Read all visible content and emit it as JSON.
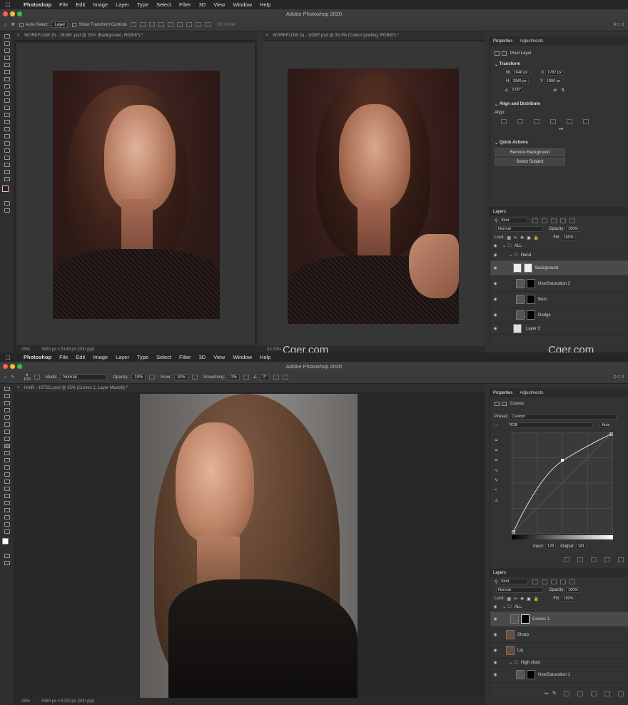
{
  "menu": {
    "app": "Photoshop",
    "items": [
      "File",
      "Edit",
      "Image",
      "Layer",
      "Type",
      "Select",
      "Filter",
      "3D",
      "View",
      "Window",
      "Help"
    ]
  },
  "app_title": "Adobe Photoshop 2020",
  "w1": {
    "opts": {
      "auto_select": "Auto-Select:",
      "layer": "Layer",
      "show_transform": "Show Transform Controls",
      "mode_3d": "3D Mode:"
    },
    "tab_left": "WORKFLOW 2b - 18268 .psd @ 25% (Background, RGB/8*) *",
    "tab_right": "WORKFLOW 2a - 18267.psd @ 33.3% (Colour grading, RGB/8*) *",
    "status_zoom": "25%",
    "status_size": "3433 px x 5149 px (300 ppi)",
    "status_zoom2": "33.33%",
    "props": {
      "tab1": "Properties",
      "tab2": "Adjustments",
      "kind": "Pixel Layer",
      "transform": "Transform",
      "w_label": "W",
      "w_val": "1646 px",
      "x_label": "X",
      "x_val": "1787 px",
      "h_label": "H",
      "h_val": "3349 px",
      "y_label": "Y",
      "y_val": "1800 px",
      "angle": "0.00°",
      "align": "Align and Distribute",
      "align_sub": "Align:",
      "quick": "Quick Actions",
      "remove_bg": "Remove Background",
      "select_subject": "Select Subject"
    },
    "layers": {
      "title": "Layers",
      "kind": "Kind",
      "blend": "Normal",
      "opacity_l": "Opacity:",
      "opacity": "100%",
      "lock": "Lock:",
      "fill_l": "Fill:",
      "fill": "100%",
      "items": [
        "ALL",
        "Hand",
        "Background",
        "Hue/Saturation 2",
        "Burn",
        "Dodge",
        "Layer 3"
      ]
    }
  },
  "w2": {
    "opts": {
      "brush_size": "100",
      "mode_l": "Mode:",
      "mode": "Normal",
      "opacity_l": "Opacity:",
      "opacity": "10%",
      "flow_l": "Flow:",
      "flow": "10%",
      "smooth_l": "Smoothing:",
      "smooth": "0%",
      "angle": "0°"
    },
    "tab": "HAIR - 107211.psd @ 25% (Curves 1, Layer Mask/8) *",
    "status_zoom": "25%",
    "status_size": "4480 px x 6720 px (300 ppi)",
    "props": {
      "tab1": "Properties",
      "tab2": "Adjustments",
      "kind": "Curves",
      "preset_l": "Preset:",
      "preset": "Custom",
      "channel": "RGB",
      "auto": "Auto",
      "input_l": "Input:",
      "input": "128",
      "output_l": "Output:",
      "output": "181"
    },
    "layers": {
      "title": "Layers",
      "kind": "Kind",
      "blend": "Normal",
      "opacity_l": "Opacity:",
      "opacity": "100%",
      "lock": "Lock:",
      "fill_l": "Fill:",
      "fill": "100%",
      "items": [
        "ALL",
        "Curves 1",
        "Sharp",
        "Liq",
        "High shad",
        "Hue/Saturation 1"
      ]
    }
  },
  "watermark": "Cger.com",
  "colors": {
    "accent": "#5a8cc8",
    "panel": "#333333",
    "canvas": "#282828"
  }
}
